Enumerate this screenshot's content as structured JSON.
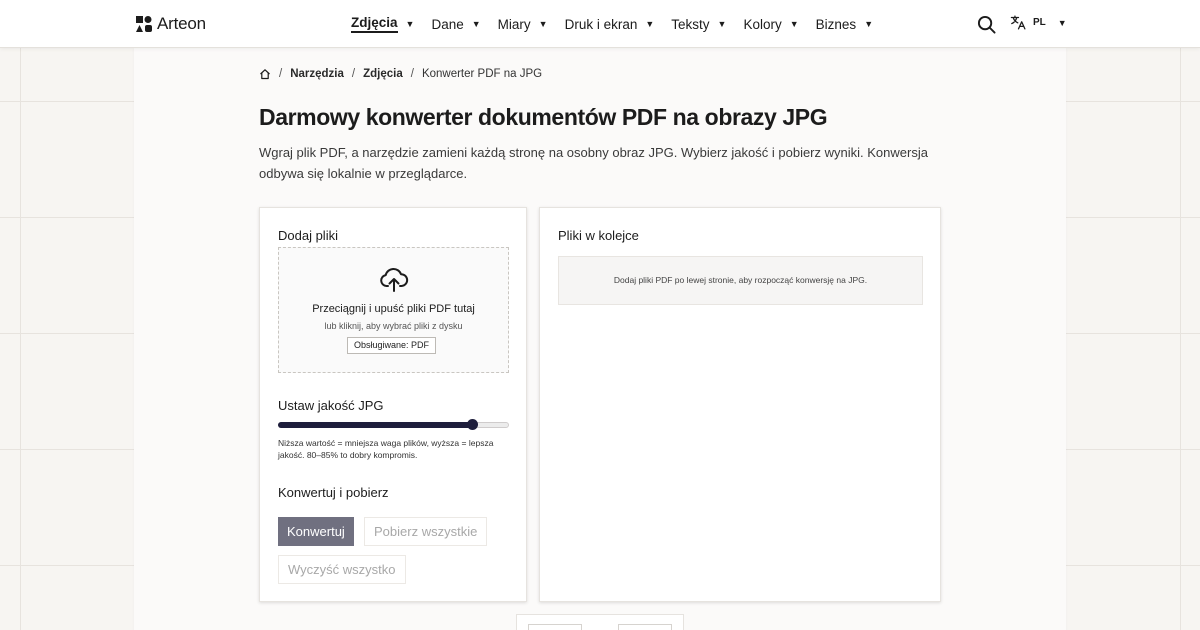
{
  "header": {
    "logo_text": "Arteon",
    "nav": [
      {
        "label": "Zdjęcia",
        "active": true
      },
      {
        "label": "Dane"
      },
      {
        "label": "Miary"
      },
      {
        "label": "Druk i ekran"
      },
      {
        "label": "Teksty"
      },
      {
        "label": "Kolory"
      },
      {
        "label": "Biznes"
      }
    ],
    "language": "PL"
  },
  "breadcrumb": {
    "items": [
      "Narzędzia",
      "Zdjęcia"
    ],
    "current": "Konwerter PDF na JPG"
  },
  "page": {
    "title": "Darmowy konwerter dokumentów PDF na obrazy JPG",
    "description": "Wgraj plik PDF, a narzędzie zamieni każdą stronę na osobny obraz JPG. Wybierz jakość i pobierz wyniki. Konwersja odbywa się lokalnie w przeglądarce."
  },
  "upload": {
    "title": "Dodaj pliki",
    "drop_title": "Przeciągnij i upuść pliki PDF tutaj",
    "drop_sub": "lub kliknij, aby wybrać pliki z dysku",
    "supported": "Obsługiwane: PDF"
  },
  "quality": {
    "title": "Ustaw jakość JPG",
    "value_fraction": 0.84,
    "hint": "Niższa wartość = mniejsza waga plików, wyższa = lepsza jakość. 80–85% to dobry kompromis."
  },
  "actions": {
    "title": "Konwertuj i pobierz",
    "convert": "Konwertuj",
    "download_all": "Pobierz wszystkie",
    "clear_all": "Wyczyść wszystko"
  },
  "queue": {
    "title": "Pliki w kolejce",
    "empty": "Dodaj pliki PDF po lewej stronie, aby rozpocząć konwersję na JPG."
  },
  "colors": {
    "accent": "#1e1e3c",
    "primary_button": "#707080"
  },
  "icons": {
    "logo": "logo-icon",
    "search": "search-icon",
    "language": "translate-icon",
    "home": "home-icon",
    "upload": "cloud-upload-icon"
  }
}
